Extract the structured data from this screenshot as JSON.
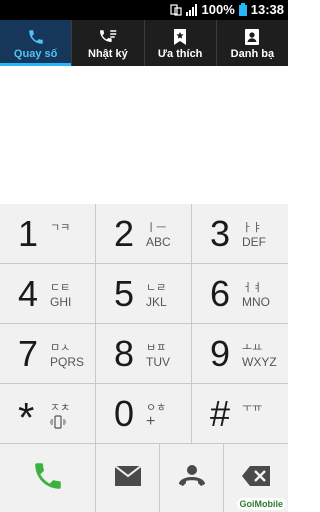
{
  "status_bar": {
    "battery": "100%",
    "time": "13:38"
  },
  "tabs": [
    {
      "label": "Quay số",
      "icon": "phone-icon",
      "active": true
    },
    {
      "label": "Nhật ký",
      "icon": "call-log-icon",
      "active": false
    },
    {
      "label": "Ưa thích",
      "icon": "favorite-bookmark-icon",
      "active": false
    },
    {
      "label": "Danh bạ",
      "icon": "contacts-icon",
      "active": false
    }
  ],
  "keypad": {
    "keys": [
      {
        "digit": "1",
        "korean": "ㄱㅋ",
        "letters": ""
      },
      {
        "digit": "2",
        "korean": "ㅣㅡ",
        "letters": "ABC"
      },
      {
        "digit": "3",
        "korean": "ㅏㅑ",
        "letters": "DEF"
      },
      {
        "digit": "4",
        "korean": "ㄷㅌ",
        "letters": "GHI"
      },
      {
        "digit": "5",
        "korean": "ㄴㄹ",
        "letters": "JKL"
      },
      {
        "digit": "6",
        "korean": "ㅓㅕ",
        "letters": "MNO"
      },
      {
        "digit": "7",
        "korean": "ㅁㅅ",
        "letters": "PQRS"
      },
      {
        "digit": "8",
        "korean": "ㅂㅍ",
        "letters": "TUV"
      },
      {
        "digit": "9",
        "korean": "ㅗㅛ",
        "letters": "WXYZ"
      },
      {
        "digit": "*",
        "korean": "ㅈㅊ",
        "letters": ""
      },
      {
        "digit": "0",
        "korean": "ㅇㅎ",
        "letters": "+"
      },
      {
        "digit": "#",
        "korean": "ㅜㅠ",
        "letters": ""
      }
    ]
  },
  "actions": {
    "call_icon": "call-icon",
    "message_icon": "message-icon",
    "voicemail_icon": "hang-up-icon",
    "delete_icon": "backspace-icon"
  },
  "watermark": "GoiMobile"
}
